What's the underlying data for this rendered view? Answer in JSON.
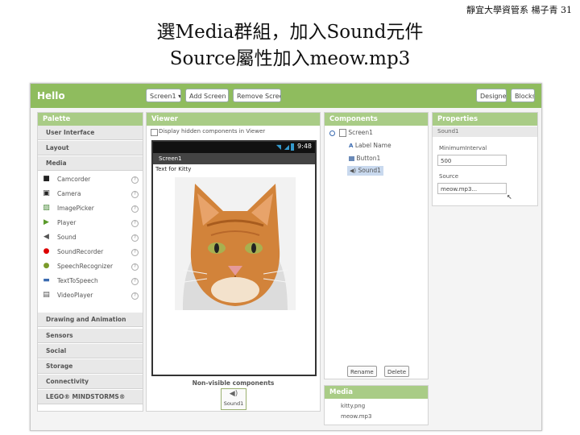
{
  "slide": {
    "credit": "靜宜大學資管系 楊子青  31",
    "title_line1": "選Media群組，加入Sound元件",
    "title_line2": "Source屬性加入meow.mp3"
  },
  "topbar": {
    "app_name": "Hello",
    "screen_select": "Screen1 ▾",
    "add_screen": "Add Screen ...",
    "remove_screen": "Remove Screen",
    "designer": "Designer",
    "blocks": "Blocks"
  },
  "palette": {
    "header": "Palette",
    "categories_top": [
      "User Interface",
      "Layout",
      "Media"
    ],
    "media_items": [
      {
        "label": "Camcorder",
        "icon": "camcorder-icon"
      },
      {
        "label": "Camera",
        "icon": "camera-icon"
      },
      {
        "label": "ImagePicker",
        "icon": "image-picker-icon"
      },
      {
        "label": "Player",
        "icon": "player-icon"
      },
      {
        "label": "Sound",
        "icon": "sound-icon"
      },
      {
        "label": "SoundRecorder",
        "icon": "sound-recorder-icon"
      },
      {
        "label": "SpeechRecognizer",
        "icon": "speech-recognizer-icon"
      },
      {
        "label": "TextToSpeech",
        "icon": "text-to-speech-icon"
      },
      {
        "label": "VideoPlayer",
        "icon": "video-player-icon"
      }
    ],
    "categories_bottom": [
      "Drawing and Animation",
      "Sensors",
      "Social",
      "Storage",
      "Connectivity",
      "LEGO® MINDSTORMS®"
    ]
  },
  "viewer": {
    "header": "Viewer",
    "checkbox_label": "Display hidden components in Viewer",
    "status_time": "9:48",
    "screen_title": "Screen1",
    "label_text": "Text for Kitty",
    "nonvisible_label": "Non-visible components",
    "nonvisible_item": "Sound1"
  },
  "components": {
    "header": "Components",
    "root": "Screen1",
    "children": [
      "Label Name",
      "Button1",
      "Sound1"
    ],
    "rename": "Rename",
    "delete": "Delete"
  },
  "media": {
    "header": "Media",
    "files": [
      "kitty.png",
      "meow.mp3"
    ]
  },
  "properties": {
    "header": "Properties",
    "component": "Sound1",
    "min_interval_label": "MinimumInterval",
    "min_interval_value": "500",
    "source_label": "Source",
    "source_value": "meow.mp3..."
  },
  "colors": {
    "topbar": "#8fbc5e",
    "panel_header": "#a9cc86",
    "selected_row": "#c9d9ee"
  }
}
